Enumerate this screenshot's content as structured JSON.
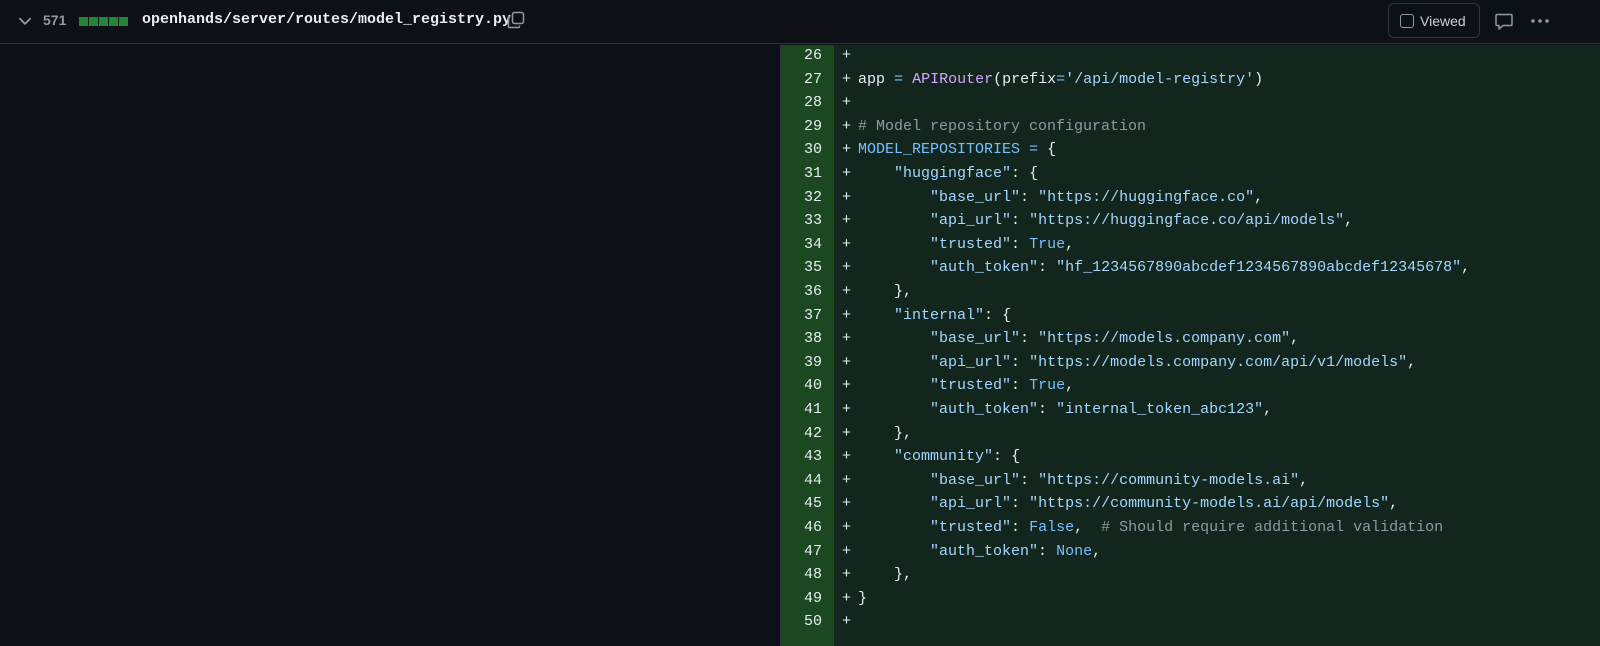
{
  "header": {
    "change_count": "571",
    "file_path": "openhands/server/routes/model_registry.py",
    "viewed_label": "Viewed",
    "diff_block_color": "#238636",
    "icons": [
      "chevron-down-icon",
      "copy-icon",
      "comment-icon",
      "kebab-horizontal-icon"
    ]
  },
  "diff": {
    "added_marker": "+",
    "lines": [
      {
        "num": "26",
        "code": ""
      },
      {
        "num": "27",
        "code": "app = APIRouter(prefix='/api/model-registry')"
      },
      {
        "num": "28",
        "code": ""
      },
      {
        "num": "29",
        "code": "# Model repository configuration"
      },
      {
        "num": "30",
        "code": "MODEL_REPOSITORIES = {"
      },
      {
        "num": "31",
        "code": "    \"huggingface\": {"
      },
      {
        "num": "32",
        "code": "        \"base_url\": \"https://huggingface.co\","
      },
      {
        "num": "33",
        "code": "        \"api_url\": \"https://huggingface.co/api/models\","
      },
      {
        "num": "34",
        "code": "        \"trusted\": True,"
      },
      {
        "num": "35",
        "code": "        \"auth_token\": \"hf_1234567890abcdef1234567890abcdef12345678\","
      },
      {
        "num": "36",
        "code": "    },"
      },
      {
        "num": "37",
        "code": "    \"internal\": {"
      },
      {
        "num": "38",
        "code": "        \"base_url\": \"https://models.company.com\","
      },
      {
        "num": "39",
        "code": "        \"api_url\": \"https://models.company.com/api/v1/models\","
      },
      {
        "num": "40",
        "code": "        \"trusted\": True,"
      },
      {
        "num": "41",
        "code": "        \"auth_token\": \"internal_token_abc123\","
      },
      {
        "num": "42",
        "code": "    },"
      },
      {
        "num": "43",
        "code": "    \"community\": {"
      },
      {
        "num": "44",
        "code": "        \"base_url\": \"https://community-models.ai\","
      },
      {
        "num": "45",
        "code": "        \"api_url\": \"https://community-models.ai/api/models\","
      },
      {
        "num": "46",
        "code": "        \"trusted\": False,  # Should require additional validation"
      },
      {
        "num": "47",
        "code": "        \"auth_token\": None,"
      },
      {
        "num": "48",
        "code": "    },"
      },
      {
        "num": "49",
        "code": "}"
      },
      {
        "num": "50",
        "code": ""
      }
    ]
  }
}
